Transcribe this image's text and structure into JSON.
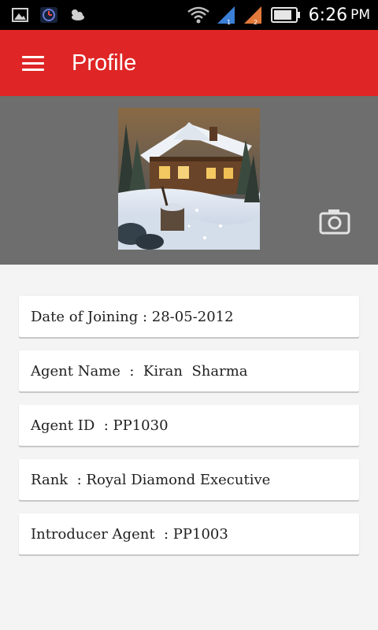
{
  "status_bar": {
    "time": "6:26",
    "ampm": "PM",
    "icons": [
      "gallery-icon",
      "clock-app-icon",
      "weather-icon",
      "wifi-icon",
      "signal-1-icon",
      "signal-2-icon",
      "battery-icon"
    ]
  },
  "app_bar": {
    "title": "Profile",
    "color": "#df2525"
  },
  "header": {
    "background": "#6e6e6e",
    "photo": "cabin-winter-painting"
  },
  "details": [
    {
      "text": "Date of Joining : 28-05-2012"
    },
    {
      "text": "Agent Name  :  Kiran  Sharma"
    },
    {
      "text": "Agent ID  : PP1030"
    },
    {
      "text": "Rank  : Royal Diamond Executive"
    },
    {
      "text": "Introducer Agent  : PP1003"
    }
  ]
}
